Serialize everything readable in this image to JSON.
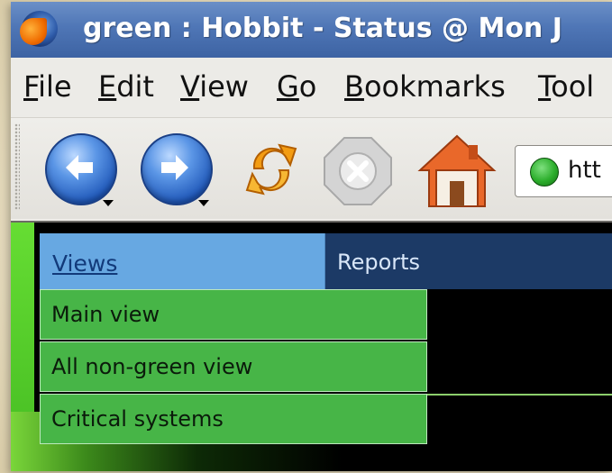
{
  "window": {
    "title": "green : Hobbit - Status @ Mon J"
  },
  "menubar": {
    "items": [
      "File",
      "Edit",
      "View",
      "Go",
      "Bookmarks",
      "Tool"
    ]
  },
  "toolbar": {
    "buttons": [
      "back-icon",
      "forward-icon",
      "reload-icon",
      "stop-icon",
      "home-icon"
    ],
    "url_text": "htt"
  },
  "page": {
    "nav": {
      "views_label": "Views",
      "reports_label": "Reports"
    },
    "dropdown": {
      "items": [
        "Main view",
        "All non-green view",
        "Critical systems"
      ]
    }
  },
  "colors": {
    "status_green": "#47b547",
    "nav_blue": "#67a8e2",
    "nav_dark": "#1c3a66"
  }
}
